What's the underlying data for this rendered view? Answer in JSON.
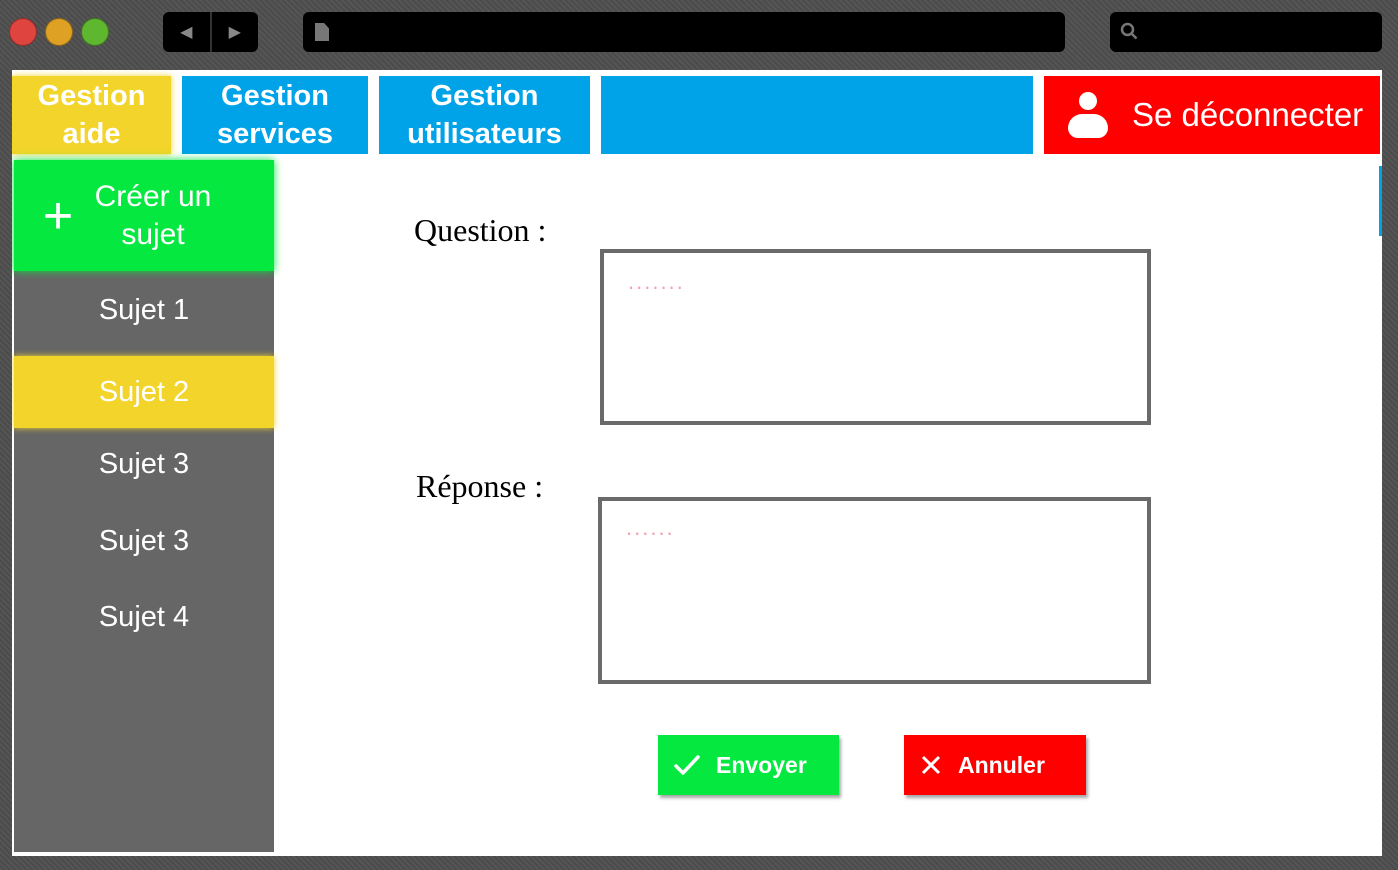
{
  "tabs": {
    "aide": "Gestion aide",
    "services": "Gestion services",
    "users": "Gestion utilisateurs",
    "logout": "Se déconnecter"
  },
  "sidebar": {
    "create": "Créer un sujet",
    "items": [
      {
        "label": "Sujet 1",
        "active": false
      },
      {
        "label": "Sujet 2",
        "active": true
      },
      {
        "label": "Sujet 3",
        "active": false
      },
      {
        "label": "Sujet 3",
        "active": false
      },
      {
        "label": "Sujet 4",
        "active": false
      }
    ]
  },
  "form": {
    "question_label": "Question :",
    "question_placeholder": ".......",
    "answer_label": "Réponse :",
    "answer_placeholder": "......"
  },
  "buttons": {
    "send": "Envoyer",
    "cancel": "Annuler"
  },
  "colors": {
    "yellow": "#f2d42a",
    "blue": "#00a2e8",
    "red": "#ff0000",
    "green": "#05e840",
    "sidebar": "#666666"
  }
}
